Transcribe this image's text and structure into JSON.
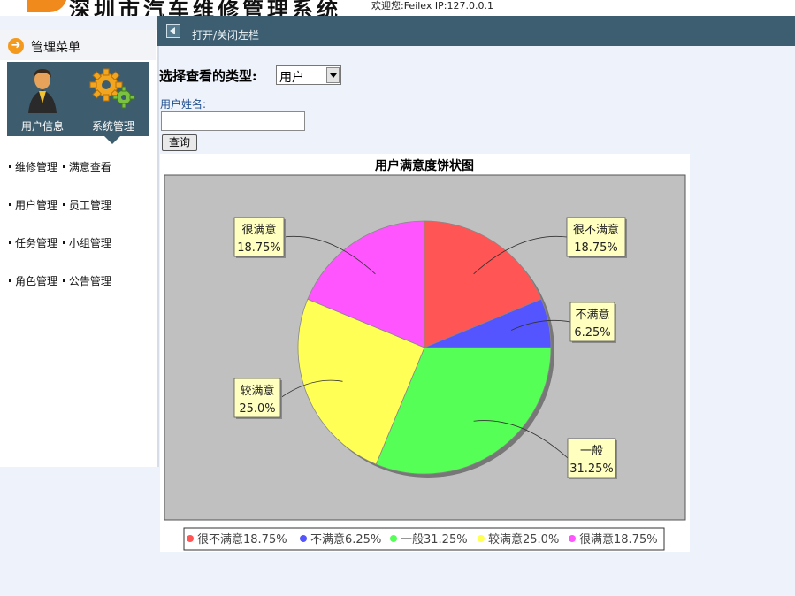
{
  "header": {
    "title": "深圳市汽车维修管理系统",
    "welcome": "欢迎您:Feilex IP:127.0.0.1"
  },
  "sidebar": {
    "menu_title": "管理菜单",
    "panel_buttons": [
      {
        "label": "用户信息",
        "icon": "user-icon"
      },
      {
        "label": "系统管理",
        "icon": "gears-icon"
      }
    ],
    "nav_rows": [
      [
        "维修管理",
        "满意查看"
      ],
      [
        "用户管理",
        "员工管理"
      ],
      [
        "任务管理",
        "小组管理"
      ],
      [
        "角色管理",
        "公告管理"
      ]
    ]
  },
  "topbar": {
    "toggle_label": "打开/关闭左栏"
  },
  "form": {
    "type_label": "选择查看的类型:",
    "type_value": "用户",
    "name_label": "用户姓名:",
    "name_value": "",
    "query_label": "查询"
  },
  "chart_data": {
    "type": "pie",
    "title": "用户满意度饼状图",
    "slices": [
      {
        "label": "很不满意",
        "value": 18.75,
        "value_label": "18.75%",
        "legend": "很不满意18.75%",
        "color": "#ff5555"
      },
      {
        "label": "不满意",
        "value": 6.25,
        "value_label": "6.25%",
        "legend": "不满意6.25%",
        "color": "#5555ff"
      },
      {
        "label": "一般",
        "value": 31.25,
        "value_label": "31.25%",
        "legend": "一般31.25%",
        "color": "#55ff55"
      },
      {
        "label": "较满意",
        "value": 25.0,
        "value_label": "25.0%",
        "legend": "较满意25.0%",
        "color": "#ffff55"
      },
      {
        "label": "很满意",
        "value": 18.75,
        "value_label": "18.75%",
        "legend": "很满意18.75%",
        "color": "#ff55ff"
      }
    ],
    "plot_background": "#c0c0c0",
    "legend_position": "bottom"
  }
}
